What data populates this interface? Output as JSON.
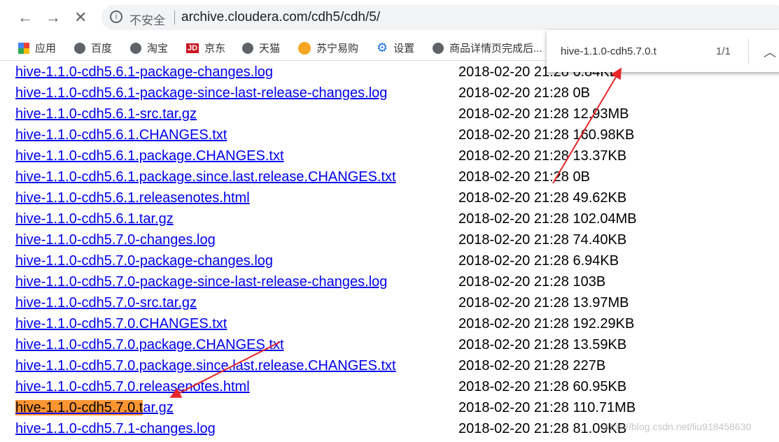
{
  "browser": {
    "url": "archive.cloudera.com/cdh5/cdh/5/",
    "security_label": "不安全"
  },
  "bookmarks": [
    {
      "label": "应用",
      "icon": "apps-grid-icon"
    },
    {
      "label": "百度",
      "icon": "globe-icon"
    },
    {
      "label": "淘宝",
      "icon": "globe-icon"
    },
    {
      "label": "京东",
      "icon": "jd-logo-icon"
    },
    {
      "label": "天猫",
      "icon": "globe-icon"
    },
    {
      "label": "苏宁易购",
      "icon": "suning-icon"
    },
    {
      "label": "设置",
      "icon": "gear-icon"
    },
    {
      "label": "商品详情页完成后...",
      "icon": "globe-icon"
    }
  ],
  "find": {
    "query": "hive-1.1.0-cdh5.7.0.t",
    "count": "1/1"
  },
  "files": [
    {
      "name": "hive-1.1.0-cdh5.6.1-package-changes.log",
      "meta": "2018-02-20 21:28 6.84KB"
    },
    {
      "name": "hive-1.1.0-cdh5.6.1-package-since-last-release-changes.log",
      "meta": "2018-02-20 21:28 0B"
    },
    {
      "name": "hive-1.1.0-cdh5.6.1-src.tar.gz",
      "meta": "2018-02-20 21:28 12.93MB"
    },
    {
      "name": "hive-1.1.0-cdh5.6.1.CHANGES.txt",
      "meta": "2018-02-20 21:28 160.98KB"
    },
    {
      "name": "hive-1.1.0-cdh5.6.1.package.CHANGES.txt",
      "meta": "2018-02-20 21:28 13.37KB"
    },
    {
      "name": "hive-1.1.0-cdh5.6.1.package.since.last.release.CHANGES.txt",
      "meta": "2018-02-20 21:28 0B"
    },
    {
      "name": "hive-1.1.0-cdh5.6.1.releasenotes.html",
      "meta": "2018-02-20 21:28 49.62KB"
    },
    {
      "name": "hive-1.1.0-cdh5.6.1.tar.gz",
      "meta": "2018-02-20 21:28 102.04MB"
    },
    {
      "name": "hive-1.1.0-cdh5.7.0-changes.log",
      "meta": "2018-02-20 21:28 74.40KB"
    },
    {
      "name": "hive-1.1.0-cdh5.7.0-package-changes.log",
      "meta": "2018-02-20 21:28 6.94KB"
    },
    {
      "name": "hive-1.1.0-cdh5.7.0-package-since-last-release-changes.log",
      "meta": "2018-02-20 21:28 103B"
    },
    {
      "name": "hive-1.1.0-cdh5.7.0-src.tar.gz",
      "meta": "2018-02-20 21:28 13.97MB"
    },
    {
      "name": "hive-1.1.0-cdh5.7.0.CHANGES.txt",
      "meta": "2018-02-20 21:28 192.29KB"
    },
    {
      "name": "hive-1.1.0-cdh5.7.0.package.CHANGES.txt",
      "meta": "2018-02-20 21:28 13.59KB"
    },
    {
      "name": "hive-1.1.0-cdh5.7.0.package.since.last.release.CHANGES.txt",
      "meta": "2018-02-20 21:28 227B"
    },
    {
      "name": "hive-1.1.0-cdh5.7.0.releasenotes.html",
      "meta": "2018-02-20 21:28 60.95KB"
    },
    {
      "name": "hive-1.1.0-cdh5.7.0.tar.gz",
      "meta": "2018-02-20 21:28 110.71MB",
      "highlight": "hive-1.1.0-cdh5.7.0.t",
      "rest": "ar.gz"
    },
    {
      "name": "hive-1.1.0-cdh5.7.1-changes.log",
      "meta": "2018-02-20 21:28 81.09KB"
    }
  ],
  "watermark": "https://blog.csdn.net/liu918458630",
  "colors": {
    "link": "#0000ee",
    "find_highlight": "#ff9632",
    "annotation_arrow": "#e8262b"
  }
}
